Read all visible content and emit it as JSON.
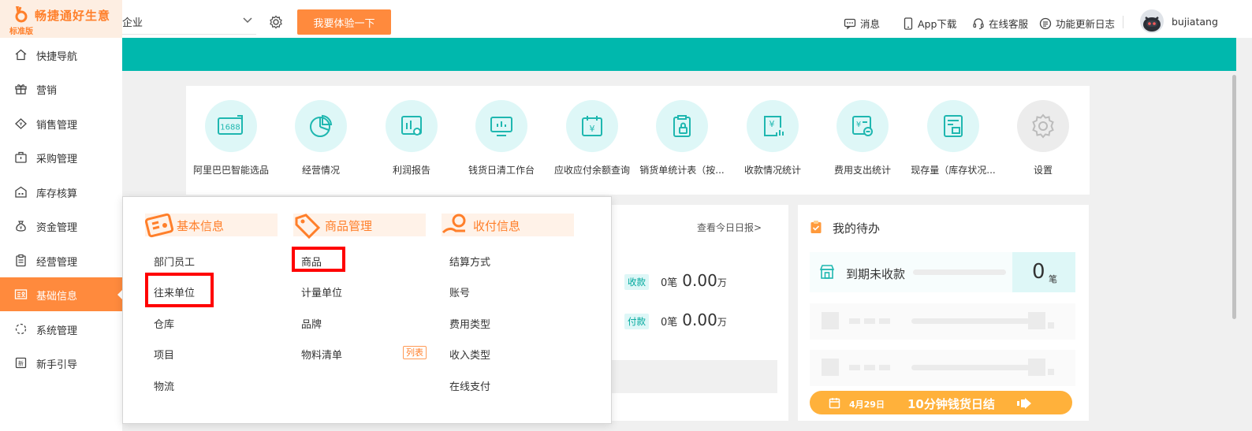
{
  "brand": {
    "name": "畅捷通好生意",
    "edition": "标准版",
    "color": "#ff7f2a"
  },
  "header": {
    "company": "企业",
    "try_button": "我要体验一下",
    "links": {
      "messages": "消息",
      "app_download": "App下载",
      "support": "在线客服",
      "changelog": "功能更新日志"
    },
    "username": "bujiatang"
  },
  "sidebar": {
    "items": [
      {
        "label": "快捷导航",
        "icon": "home-icon"
      },
      {
        "label": "营销",
        "icon": "gift-icon"
      },
      {
        "label": "销售管理",
        "icon": "sales-icon"
      },
      {
        "label": "采购管理",
        "icon": "purchase-icon"
      },
      {
        "label": "库存核算",
        "icon": "warehouse-icon"
      },
      {
        "label": "资金管理",
        "icon": "money-bag-icon"
      },
      {
        "label": "经营管理",
        "icon": "clipboard-icon"
      },
      {
        "label": "基础信息",
        "icon": "id-card-icon",
        "active": true
      },
      {
        "label": "系统管理",
        "icon": "loading-ring-icon"
      },
      {
        "label": "新手引导",
        "icon": "guide-icon"
      }
    ],
    "accent": "#ff8a3d"
  },
  "quick_nav": [
    {
      "label": "阿里巴巴智能选品",
      "icon": "1688-icon",
      "text": "1688"
    },
    {
      "label": "经营情况",
      "icon": "pie-chart-icon"
    },
    {
      "label": "利润报告",
      "icon": "report-icon"
    },
    {
      "label": "钱货日清工作台",
      "icon": "monitor-chart-icon"
    },
    {
      "label": "应收应付余额查询",
      "icon": "calendar-yen-icon"
    },
    {
      "label": "销货单统计表（按...",
      "icon": "clipboard-lock-icon"
    },
    {
      "label": "收款情况统计",
      "icon": "yen-chart-icon"
    },
    {
      "label": "费用支出统计",
      "icon": "yen-minus-icon"
    },
    {
      "label": "现存量（库存状况...",
      "icon": "stock-icon"
    },
    {
      "label": "设置",
      "icon": "gear-icon"
    }
  ],
  "report": {
    "link": "查看今日日报>",
    "receipt": {
      "tag": "收款",
      "count": "0笔",
      "amount": "0.00",
      "unit": "万"
    },
    "payment": {
      "tag": "付款",
      "count": "0笔",
      "amount": "0.00",
      "unit": "万"
    }
  },
  "todo": {
    "title": "我的待办",
    "overdue_label": "到期未收款",
    "overdue_count": "0",
    "overdue_unit": "笔",
    "banner_date": "4月29日",
    "banner_text": "10分钟钱货日结"
  },
  "flyout": {
    "columns": [
      {
        "title": "基本信息",
        "items": [
          "部门员工",
          "往来单位",
          "仓库",
          "项目",
          "物流"
        ]
      },
      {
        "title": "商品管理",
        "items": [
          "商品",
          "计量单位",
          "品牌",
          "物料清单"
        ],
        "tag": "列表"
      },
      {
        "title": "收付信息",
        "items": [
          "结算方式",
          "账号",
          "费用类型",
          "收入类型",
          "在线支付"
        ]
      }
    ],
    "highlighted": [
      "往来单位",
      "商品"
    ]
  },
  "colors": {
    "teal": "#00b8ad",
    "orange": "#ff8a3d",
    "highlight": "#ff0000"
  }
}
